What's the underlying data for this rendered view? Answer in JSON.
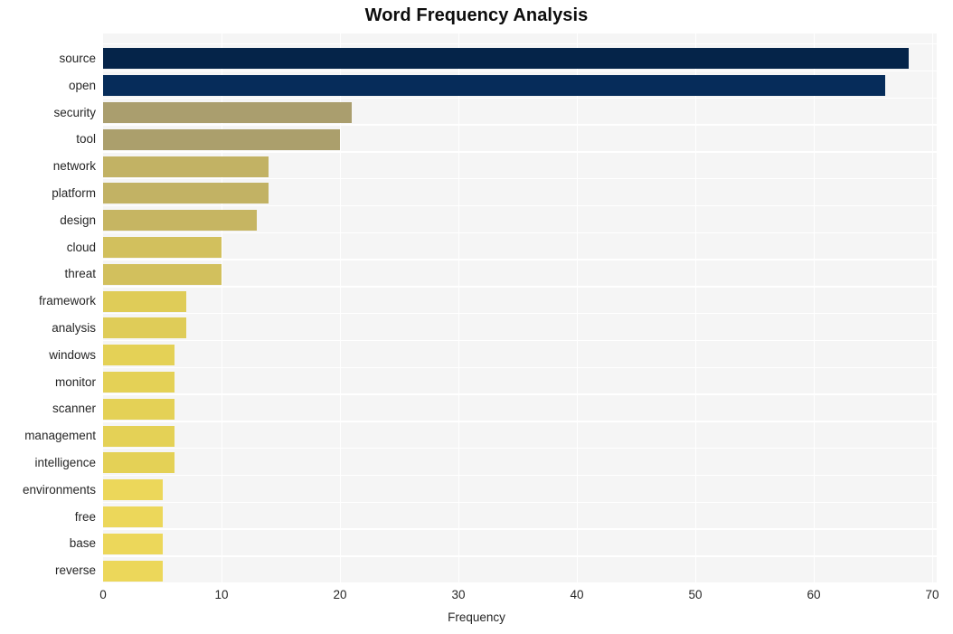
{
  "chart_data": {
    "type": "bar",
    "orientation": "horizontal",
    "title": "Word Frequency Analysis",
    "xlabel": "Frequency",
    "ylabel": "",
    "categories": [
      "source",
      "open",
      "security",
      "tool",
      "network",
      "platform",
      "design",
      "cloud",
      "threat",
      "framework",
      "analysis",
      "windows",
      "monitor",
      "scanner",
      "management",
      "intelligence",
      "environments",
      "free",
      "base",
      "reverse"
    ],
    "values": [
      68,
      66,
      21,
      20,
      14,
      14,
      13,
      10,
      10,
      7,
      7,
      6,
      6,
      6,
      6,
      6,
      5,
      5,
      5,
      5
    ],
    "bar_colors": [
      "#052449",
      "#062c5a",
      "#aa9e6e",
      "#ab9f6c",
      "#c2b264",
      "#c2b264",
      "#c6b562",
      "#d2c05d",
      "#d2c05d",
      "#dfcc58",
      "#dfcc58",
      "#e4d156",
      "#e4d156",
      "#e4d156",
      "#e4d156",
      "#e4d156",
      "#ecd75a",
      "#ecd75a",
      "#ecd75a",
      "#ecd75a"
    ],
    "xlim": [
      0,
      70
    ],
    "xticks": [
      0,
      10,
      20,
      30,
      40,
      50,
      60,
      70
    ],
    "xtick_labels": [
      "0",
      "10",
      "20",
      "30",
      "40",
      "50",
      "60",
      "70"
    ],
    "grid": true,
    "grid_color": "#ffffff",
    "plot_background": "#f5f5f5",
    "figure_background": "#ffffff",
    "legend": null,
    "annotations": []
  }
}
